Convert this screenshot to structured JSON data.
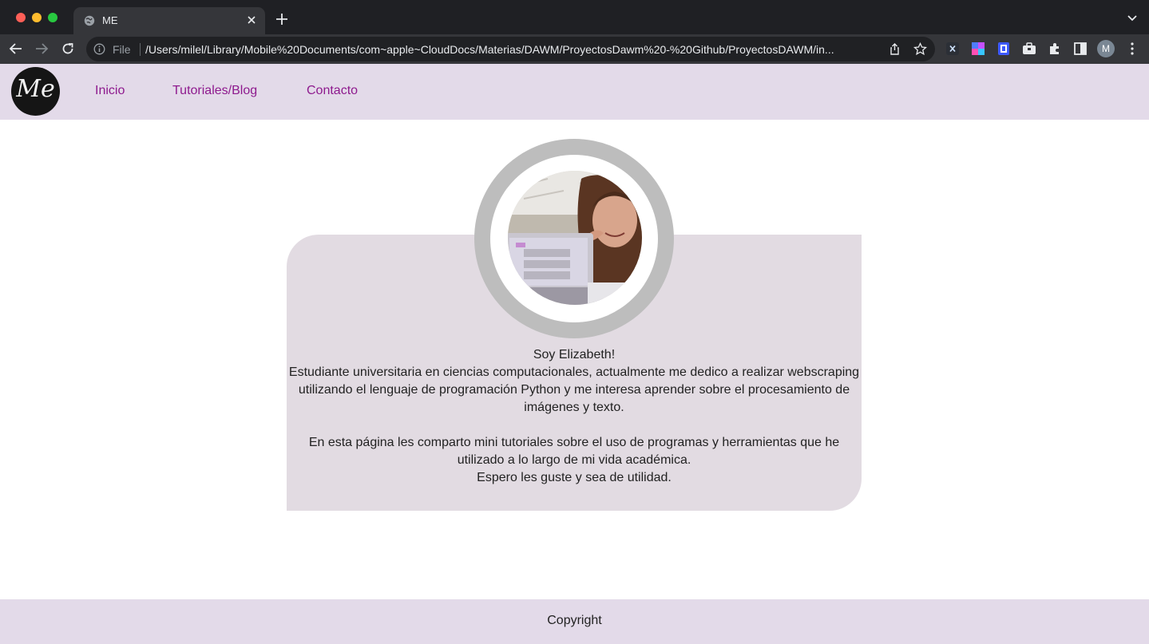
{
  "browser": {
    "tab_title": "ME",
    "file_label": "File",
    "url": "/Users/milel/Library/Mobile%20Documents/com~apple~CloudDocs/Materias/DAWM/ProyectosDawm%20-%20Github/ProyectosDAWM/in...",
    "profile_initial": "M"
  },
  "header": {
    "logo_text": "Me",
    "nav": [
      {
        "label": "Inicio"
      },
      {
        "label": "Tutoriales/Blog"
      },
      {
        "label": "Contacto"
      }
    ]
  },
  "about": {
    "greeting": "Soy Elizabeth!",
    "intro": "Estudiante universitaria en ciencias computacionales, actualmente me dedico a realizar webscraping utilizando el lenguaje de programación Python y me interesa aprender sobre el procesamiento de imágenes y texto.",
    "tutorials": "En esta página les comparto mini tutoriales sobre el uso de programas y herramientas que he utilizado a lo largo de mi vida académica.",
    "closing": "Espero les guste y sea de utilidad."
  },
  "footer": {
    "copyright": "Copyright"
  },
  "colors": {
    "header_bg": "#e3dae9",
    "nav_link": "#8e1a8e",
    "card_bg": "#e2dbe2",
    "ring": "#bdbdbd"
  }
}
